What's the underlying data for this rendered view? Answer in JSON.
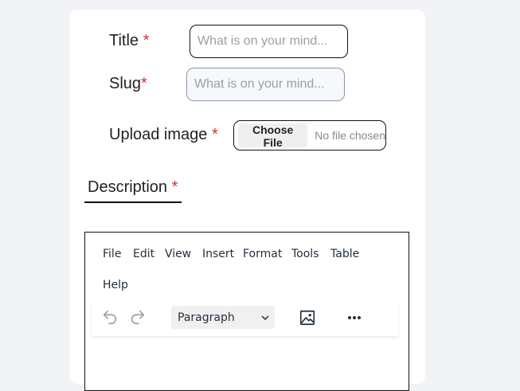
{
  "form": {
    "title_label": "Title",
    "slug_label": "Slug",
    "upload_label": "Upload image",
    "required_mark": "*",
    "title_placeholder": "What is on your mind...",
    "slug_placeholder": "What is on your mind...",
    "file_button": "Choose File",
    "file_status": "No file chosen"
  },
  "tabs": {
    "description": "Description"
  },
  "editor": {
    "menu": [
      "File",
      "Edit",
      "View",
      "Insert",
      "Format",
      "Tools",
      "Table",
      "Help"
    ],
    "block_format": "Paragraph",
    "icons": [
      "undo-icon",
      "redo-icon",
      "chevron-down-icon",
      "image-icon",
      "more-icon"
    ]
  }
}
